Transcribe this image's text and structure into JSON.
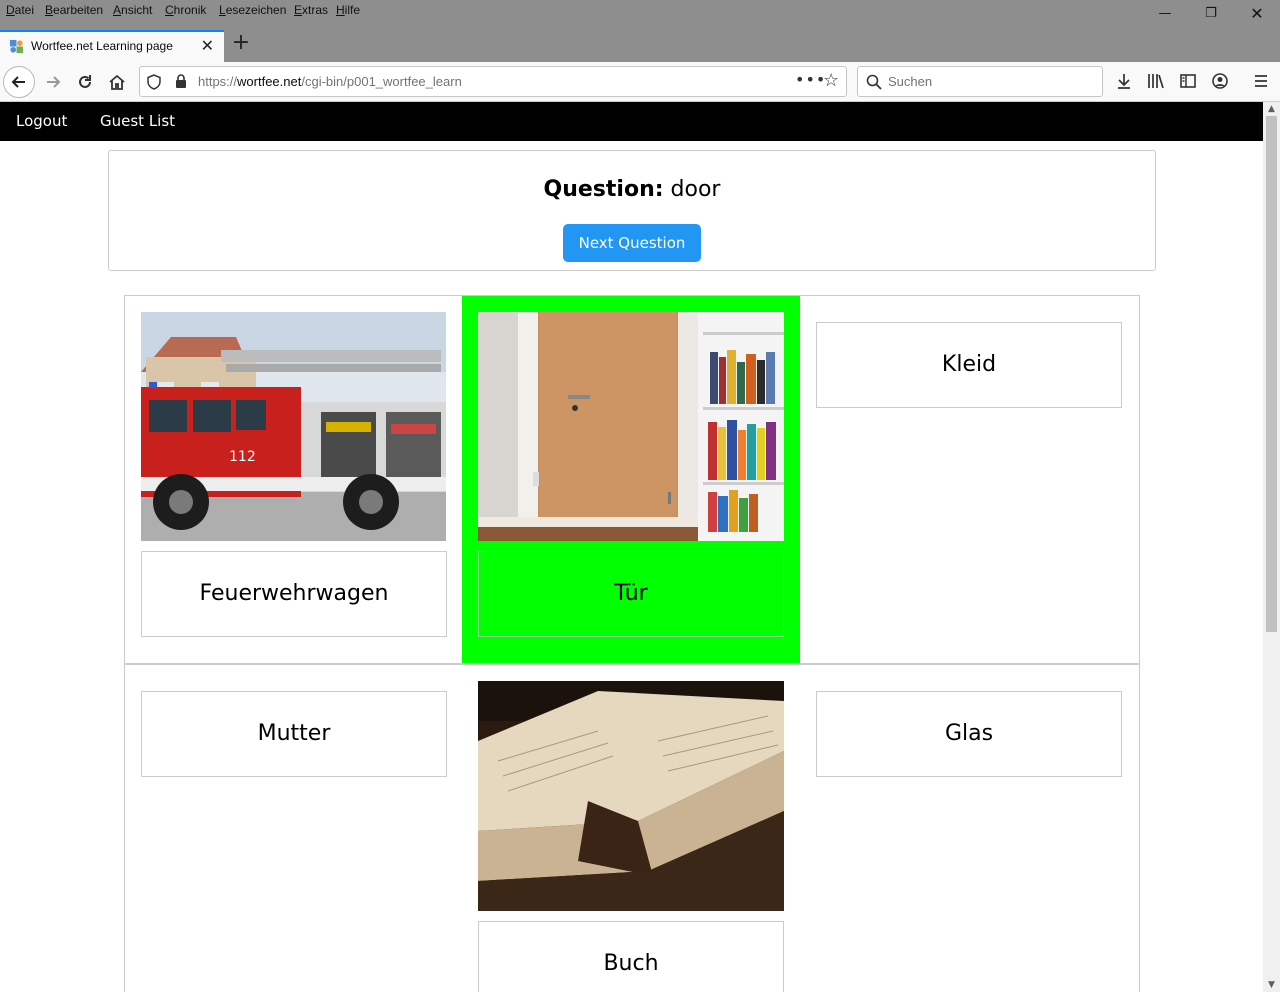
{
  "browser": {
    "menu": [
      "Datei",
      "Bearbeiten",
      "Ansicht",
      "Chronik",
      "Lesezeichen",
      "Extras",
      "Hilfe"
    ],
    "tab_title": "Wortfee.net Learning page",
    "url_prefix": "https://",
    "url_host": "wortfee.net",
    "url_path": "/cgi-bin/p001_wortfee_learn",
    "search_placeholder": "Suchen"
  },
  "nav": {
    "logout": "Logout",
    "guest_list": "Guest List"
  },
  "question": {
    "label": "Question:",
    "word": "door",
    "next_button": "Next Question"
  },
  "cards": [
    {
      "word": "Feuerwehrwagen",
      "image": "fire-truck",
      "correct": false
    },
    {
      "word": "Tür",
      "image": "door",
      "correct": true
    },
    {
      "word": "Kleid",
      "image": null,
      "correct": false
    },
    {
      "word": "Mutter",
      "image": null,
      "correct": false
    },
    {
      "word": "Buch",
      "image": "book",
      "correct": false
    },
    {
      "word": "Glas",
      "image": null,
      "correct": false
    }
  ],
  "colors": {
    "correct_highlight": "#00ff00",
    "button_blue": "#2196f3",
    "nav_bg": "#000000"
  }
}
